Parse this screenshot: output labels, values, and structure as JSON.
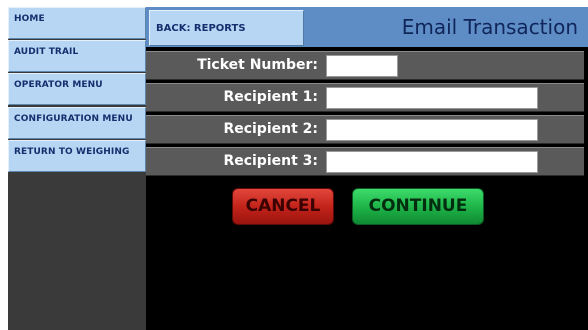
{
  "sidebar": {
    "items": [
      {
        "label": "HOME"
      },
      {
        "label": "AUDIT TRAIL"
      },
      {
        "label": "OPERATOR MENU"
      },
      {
        "label": "CONFIGURATION MENU"
      },
      {
        "label": "RETURN TO WEIGHING"
      }
    ]
  },
  "header": {
    "back_label": "BACK: REPORTS",
    "title": "Email Transaction"
  },
  "form": {
    "ticket_number": {
      "label": "Ticket Number:",
      "value": ""
    },
    "recipient_1": {
      "label": "Recipient 1:",
      "value": ""
    },
    "recipient_2": {
      "label": "Recipient 2:",
      "value": ""
    },
    "recipient_3": {
      "label": "Recipient 3:",
      "value": ""
    }
  },
  "actions": {
    "cancel_label": "CANCEL",
    "continue_label": "CONTINUE"
  },
  "colors": {
    "nav_button": "#b7d6f3",
    "header_bar": "#5e8dc6",
    "form_row": "#5a5a5a",
    "cancel": "#c2241b",
    "continue": "#1fb549"
  }
}
